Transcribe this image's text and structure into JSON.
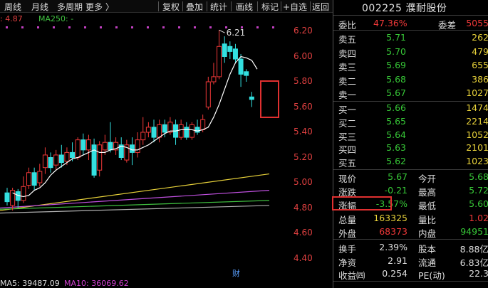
{
  "toolbar": {
    "left_items": [
      "周线",
      "月线",
      "多周期",
      "更多 〉"
    ],
    "right_items": [
      "复权",
      "叠加",
      "统计",
      "画线",
      "标记",
      "+自选",
      "返回"
    ]
  },
  "indicators": {
    "partial_value": ": 4.87",
    "ma250_label": "MA250: -",
    "ma5_label": "MA5: 39487.09",
    "ma10_label": "MA10: 36069.62",
    "cai_marker": "财"
  },
  "chart": {
    "peak_label": "6.21",
    "price_ticks": [
      "6.20",
      "6.00",
      "5.80",
      "5.60",
      "5.40",
      "5.20",
      "5.00",
      "4.80",
      "4.60",
      "4.40"
    ]
  },
  "chart_data": {
    "type": "candlestick",
    "ylim": [
      4.3,
      6.3
    ],
    "price_ticks": [
      6.2,
      6.0,
      5.8,
      5.6,
      5.4,
      5.2,
      5.0,
      4.8,
      4.6,
      4.4
    ],
    "annotations": [
      {
        "text": "6.21",
        "value": 6.21
      }
    ],
    "candles": [
      {
        "o": 4.92,
        "c": 4.85,
        "h": 4.96,
        "l": 4.82
      },
      {
        "o": 4.82,
        "c": 4.94,
        "h": 4.96,
        "l": 4.78
      },
      {
        "o": 4.93,
        "c": 4.86,
        "h": 4.95,
        "l": 4.8
      },
      {
        "o": 4.86,
        "c": 4.97,
        "h": 5.05,
        "l": 4.84
      },
      {
        "o": 4.98,
        "c": 5.08,
        "h": 5.12,
        "l": 4.95
      },
      {
        "o": 5.08,
        "c": 4.98,
        "h": 5.12,
        "l": 4.94
      },
      {
        "o": 5.0,
        "c": 5.09,
        "h": 5.15,
        "l": 4.97
      },
      {
        "o": 5.12,
        "c": 5.22,
        "h": 5.28,
        "l": 5.07
      },
      {
        "o": 5.2,
        "c": 5.12,
        "h": 5.24,
        "l": 5.08
      },
      {
        "o": 5.14,
        "c": 5.22,
        "h": 5.26,
        "l": 5.1
      },
      {
        "o": 5.22,
        "c": 5.16,
        "h": 5.3,
        "l": 5.12
      },
      {
        "o": 5.17,
        "c": 5.24,
        "h": 5.28,
        "l": 5.14
      },
      {
        "o": 5.24,
        "c": 5.2,
        "h": 5.32,
        "l": 5.17
      },
      {
        "o": 5.2,
        "c": 5.34,
        "h": 5.36,
        "l": 5.18
      },
      {
        "o": 5.34,
        "c": 5.26,
        "h": 5.39,
        "l": 5.22
      },
      {
        "o": 5.26,
        "c": 5.34,
        "h": 5.38,
        "l": 5.18
      },
      {
        "o": 5.3,
        "c": 5.06,
        "h": 5.35,
        "l": 5.04
      },
      {
        "o": 5.1,
        "c": 5.3,
        "h": 5.33,
        "l": 5.05
      },
      {
        "o": 5.26,
        "c": 5.32,
        "h": 5.38,
        "l": 5.22
      },
      {
        "o": 5.32,
        "c": 5.26,
        "h": 5.48,
        "l": 5.24
      },
      {
        "o": 5.26,
        "c": 5.32,
        "h": 5.36,
        "l": 5.22
      },
      {
        "o": 5.3,
        "c": 5.2,
        "h": 5.36,
        "l": 5.18
      },
      {
        "o": 5.18,
        "c": 5.3,
        "h": 5.34,
        "l": 5.16
      },
      {
        "o": 5.3,
        "c": 5.24,
        "h": 5.36,
        "l": 5.14
      },
      {
        "o": 5.24,
        "c": 5.34,
        "h": 5.4,
        "l": 5.2
      },
      {
        "o": 5.34,
        "c": 5.4,
        "h": 5.52,
        "l": 5.3
      },
      {
        "o": 5.4,
        "c": 5.44,
        "h": 5.48,
        "l": 5.36
      },
      {
        "o": 5.44,
        "c": 5.36,
        "h": 5.5,
        "l": 5.32
      },
      {
        "o": 5.36,
        "c": 5.46,
        "h": 5.5,
        "l": 5.32
      },
      {
        "o": 5.46,
        "c": 5.4,
        "h": 5.5,
        "l": 5.36
      },
      {
        "o": 5.4,
        "c": 5.48,
        "h": 5.52,
        "l": 5.38
      },
      {
        "o": 5.46,
        "c": 5.36,
        "h": 5.5,
        "l": 5.3
      },
      {
        "o": 5.36,
        "c": 5.46,
        "h": 5.5,
        "l": 5.34
      },
      {
        "o": 5.44,
        "c": 5.36,
        "h": 5.48,
        "l": 5.34
      },
      {
        "o": 5.36,
        "c": 5.46,
        "h": 5.48,
        "l": 5.34
      },
      {
        "o": 5.44,
        "c": 5.4,
        "h": 5.5,
        "l": 5.38
      },
      {
        "o": 5.42,
        "c": 5.5,
        "h": 5.54,
        "l": 5.4
      },
      {
        "o": 5.6,
        "c": 5.8,
        "h": 5.84,
        "l": 5.58
      },
      {
        "o": 5.8,
        "c": 5.84,
        "h": 5.95,
        "l": 5.78
      },
      {
        "o": 5.84,
        "c": 6.08,
        "h": 6.21,
        "l": 5.82
      },
      {
        "o": 6.1,
        "c": 6.0,
        "h": 6.16,
        "l": 5.95
      },
      {
        "o": 6.08,
        "c": 6.04,
        "h": 6.12,
        "l": 5.98
      },
      {
        "o": 6.06,
        "c": 5.98,
        "h": 6.1,
        "l": 5.95
      },
      {
        "o": 5.98,
        "c": 5.86,
        "h": 6.02,
        "l": 5.76
      },
      {
        "o": 5.88,
        "c": 5.85,
        "h": 5.9,
        "l": 5.8
      },
      {
        "o": 5.68,
        "c": 5.66,
        "h": 5.72,
        "l": 5.6
      }
    ],
    "ma5": [
      4.92,
      4.9,
      4.89,
      4.9,
      4.94,
      4.96,
      5.0,
      5.06,
      5.1,
      5.13,
      5.16,
      5.19,
      5.2,
      5.22,
      5.24,
      5.26,
      5.24,
      5.24,
      5.26,
      5.27,
      5.29,
      5.28,
      5.26,
      5.26,
      5.28,
      5.3,
      5.33,
      5.36,
      5.39,
      5.41,
      5.41,
      5.42,
      5.42,
      5.42,
      5.41,
      5.42,
      5.44,
      5.52,
      5.62,
      5.74,
      5.86,
      5.95,
      6.0,
      5.99,
      5.97,
      5.9
    ],
    "ma_long": [
      {
        "color": "#e8d23a",
        "from": 4.78,
        "to": 5.07
      },
      {
        "color": "#c050e0",
        "from": 4.8,
        "to": 4.94
      },
      {
        "color": "#40c040",
        "from": 4.79,
        "to": 4.86
      },
      {
        "color": "#b0b0b0",
        "from": 4.76,
        "to": 4.82
      }
    ]
  },
  "stock": {
    "code": "002225",
    "name": "濮耐股份",
    "committee": {
      "ratio_label": "委比",
      "ratio": "47.36%",
      "diff_label": "委差",
      "diff": "5055"
    },
    "asks": [
      {
        "label": "卖五",
        "price": "5.71",
        "vol": "262"
      },
      {
        "label": "卖四",
        "price": "5.70",
        "vol": "479"
      },
      {
        "label": "卖三",
        "price": "5.69",
        "vol": "655"
      },
      {
        "label": "卖二",
        "price": "5.68",
        "vol": "386"
      },
      {
        "label": "卖一",
        "price": "5.67",
        "vol": "1027"
      }
    ],
    "bids": [
      {
        "label": "买一",
        "price": "5.66",
        "vol": "1474"
      },
      {
        "label": "买二",
        "price": "5.65",
        "vol": "2214"
      },
      {
        "label": "买三",
        "price": "5.64",
        "vol": "1052"
      },
      {
        "label": "买四",
        "price": "5.63",
        "vol": "2101"
      },
      {
        "label": "买五",
        "price": "5.62",
        "vol": "1023"
      }
    ],
    "stats": [
      {
        "l1": "现价",
        "v1": "5.67",
        "c1": "green",
        "l2": "今开",
        "v2": "5.68",
        "c2": "green"
      },
      {
        "l1": "涨跌",
        "v1": "-0.21",
        "c1": "green",
        "l2": "最高",
        "v2": "5.72",
        "c2": "green"
      },
      {
        "l1": "涨幅",
        "v1": "-3.57%",
        "c1": "green",
        "l2": "最低",
        "v2": "5.60",
        "c2": "green"
      },
      {
        "l1": "总量",
        "v1": "163325",
        "c1": "yellow",
        "l2": "量比",
        "v2": "1.02",
        "c2": "red"
      },
      {
        "l1": "外盘",
        "v1": "68373",
        "c1": "red",
        "l2": "内盘",
        "v2": "94951",
        "c2": "green"
      }
    ],
    "fundamentals": [
      {
        "l1": "换手",
        "v1": "2.39%",
        "l2": "股本",
        "v2": "8.88亿"
      },
      {
        "l1": "净资",
        "v1": "2.91",
        "l2": "流通",
        "v2": "6.83亿"
      },
      {
        "l1": "收益㈣",
        "v1": "0.254",
        "l2": "PE(动)",
        "v2": "22.3"
      }
    ]
  },
  "colors": {
    "up": "#f03838",
    "down": "#33e0e0",
    "ma5": "#ffffff",
    "highlight_box": "#e03030"
  }
}
